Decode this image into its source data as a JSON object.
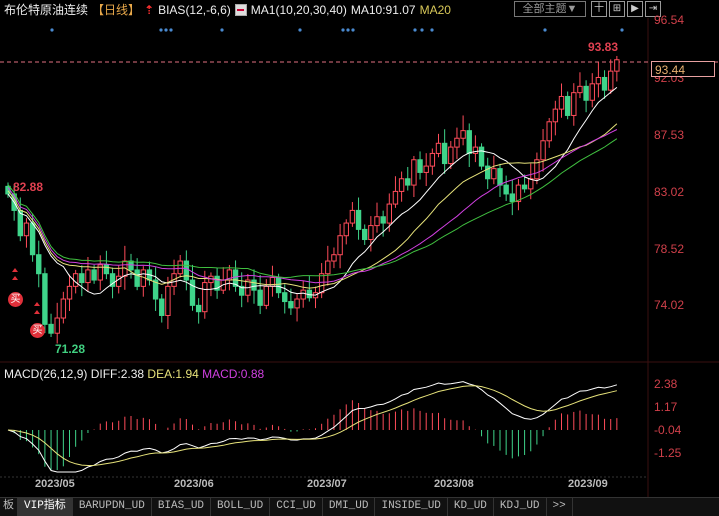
{
  "header": {
    "title": "布伦特原油连续",
    "period": "【日线】",
    "bias": "BIAS(12,-6,6)",
    "ma_params": "MA1(10,20,30,40)",
    "ma10": "MA10:91.07",
    "ma20": "MA20",
    "theme_button": "全部主题▼",
    "tool_buttons": [
      "十",
      "⊞",
      "▶",
      "⇥"
    ]
  },
  "price_axis": {
    "labels": [
      "96.54",
      "92.03",
      "87.53",
      "83.02",
      "78.52",
      "74.02"
    ],
    "current_price": "93.44",
    "high_label": "93.83"
  },
  "annotations": {
    "peak": "82.88",
    "trough": "71.28",
    "buy": "买"
  },
  "macd": {
    "title": "MACD(26,12,9)",
    "diff": "DIFF:2.38",
    "dea": "DEA:1.94",
    "macd": "MACD:0.88",
    "axis_labels": [
      "2.38",
      "1.17",
      "-0.04",
      "-1.25"
    ]
  },
  "dates": [
    "2023/05",
    "2023/06",
    "2023/07",
    "2023/08",
    "2023/09"
  ],
  "tabs": [
    "板",
    "VIP指标",
    "BARUPDN_UD",
    "BIAS_UD",
    "BOLL_UD",
    "CCI_UD",
    "DMI_UD",
    "INSIDE_UD",
    "KD_UD",
    "KDJ_UD",
    ">>"
  ],
  "colors": {
    "up": "#ff4c5a",
    "down": "#3fd48a",
    "ma10": "#ffffff",
    "ma20": "#e6e27a",
    "ma30": "#d040e0",
    "ma40": "#40c040"
  },
  "chart_data": {
    "type": "candlestick",
    "closes": [
      82.8,
      81.5,
      79.5,
      80.5,
      78.0,
      76.5,
      72.5,
      71.8,
      73.0,
      74.5,
      75.5,
      76.5,
      75.8,
      76.8,
      76.0,
      77.2,
      76.5,
      75.5,
      76.3,
      77.5,
      76.8,
      75.5,
      76.8,
      76.0,
      74.5,
      73.2,
      75.5,
      76.5,
      77.5,
      76.0,
      74.0,
      73.5,
      75.8,
      76.3,
      75.2,
      76.0,
      76.8,
      75.5,
      74.8,
      76.0,
      75.2,
      74.0,
      75.5,
      76.2,
      75.0,
      74.3,
      73.8,
      74.5,
      75.2,
      74.6,
      75.0,
      76.5,
      77.5,
      78.0,
      79.5,
      80.5,
      81.5,
      80.0,
      79.2,
      80.3,
      81.0,
      80.5,
      82.0,
      83.0,
      84.0,
      83.5,
      85.5,
      84.5,
      85.0,
      86.0,
      86.8,
      85.2,
      86.5,
      87.2,
      87.8,
      86.0,
      86.5,
      85.0,
      84.0,
      84.8,
      83.5,
      82.8,
      82.2,
      83.5,
      83.2,
      84.0,
      85.5,
      87.0,
      88.5,
      89.5,
      90.5,
      89.0,
      90.8,
      91.3,
      90.2,
      91.5,
      92.0,
      91.0,
      92.5,
      93.4
    ],
    "ylim": [
      72.0,
      96.54
    ],
    "ma_periods": [
      10,
      20,
      30,
      40
    ]
  }
}
